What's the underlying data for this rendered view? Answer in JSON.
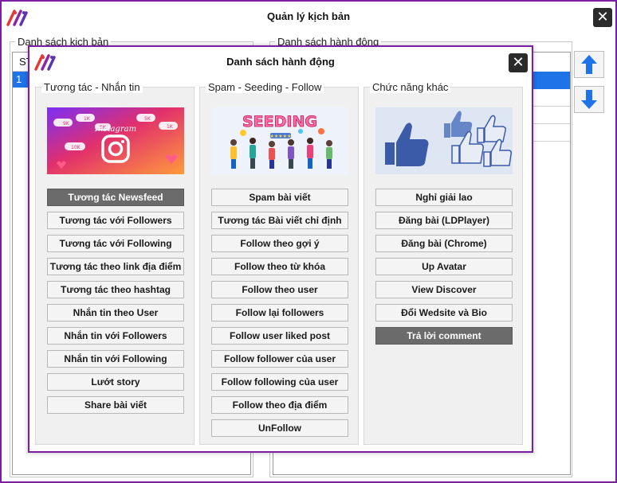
{
  "main_window": {
    "title": "Quản lý kịch bản",
    "script_list": {
      "legend": "Danh sách kịch bản",
      "column_header": "ST",
      "rows": [
        "1"
      ]
    },
    "action_list": {
      "legend": "Danh sách hành động"
    }
  },
  "dialog": {
    "title": "Danh sách hành động",
    "panels": [
      {
        "legend": "Tương tác - Nhắn tin",
        "image_label": "Instagram",
        "image_counts": [
          "9K",
          "1K",
          "5K",
          "5K",
          "1K",
          "10K"
        ],
        "buttons": [
          "Tương tác Newsfeed",
          "Tương tác với Followers",
          "Tương tác với Following",
          "Tương tác theo link địa điểm",
          "Tương tác theo hashtag",
          "Nhắn tin theo User",
          "Nhắn tin với Followers",
          "Nhắn tin với Following",
          "Lướt story",
          "Share bài viết"
        ]
      },
      {
        "legend": "Spam - Seeding - Follow",
        "image_label": "SEEDING",
        "buttons": [
          "Spam bài viết",
          "Tương tác Bài viết chỉ định",
          "Follow theo gợi ý",
          "Follow theo từ khóa",
          "Follow theo user",
          "Follow lại followers",
          "Follow user liked post",
          "Follow follower của user",
          "Follow following của user",
          "Follow theo địa điểm",
          "UnFollow"
        ]
      },
      {
        "legend": "Chức năng khác",
        "buttons": [
          "Nghỉ giải lao",
          "Đăng bài (LDPlayer)",
          "Đăng bài (Chrome)",
          "Up Avatar",
          "View Discover",
          "Đổi Wedsite và Bio",
          "Trả lời comment"
        ]
      }
    ]
  },
  "colors": {
    "accent": "#7b1fa2",
    "selection": "#1e73e8",
    "active_button": "#6b6b6b",
    "arrow": "#1e73e8"
  }
}
